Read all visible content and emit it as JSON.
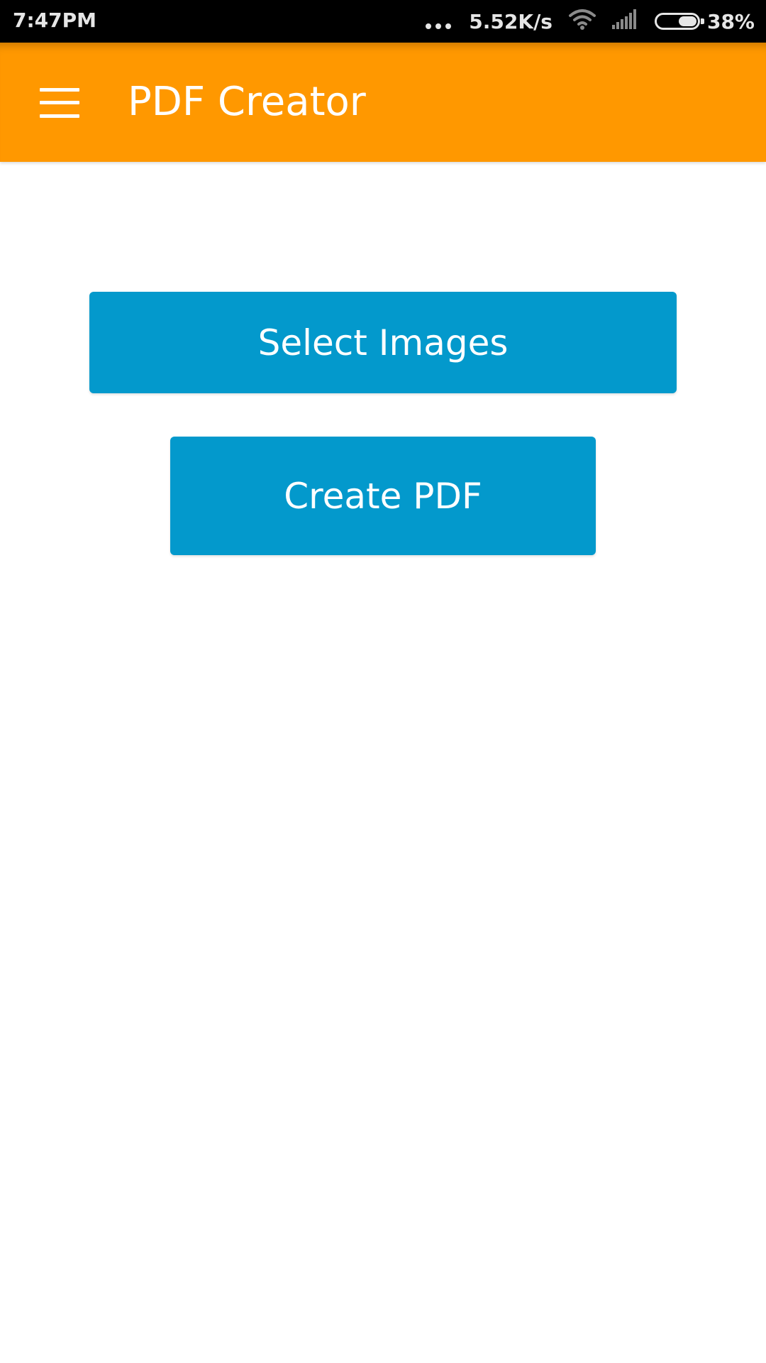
{
  "status_bar": {
    "time": "7:47PM",
    "net_speed": "5.52K/s",
    "battery_pct": "38%",
    "battery_level": 0.38,
    "icons": [
      "more-dots-icon",
      "wifi-icon",
      "signal-icon",
      "battery-icon"
    ]
  },
  "app_bar": {
    "title": "PDF Creator",
    "menu_icon": "hamburger-menu-icon",
    "color": "#ff9800"
  },
  "main": {
    "select_images_label": "Select Images",
    "create_pdf_label": "Create PDF",
    "button_color": "#0399cc"
  }
}
